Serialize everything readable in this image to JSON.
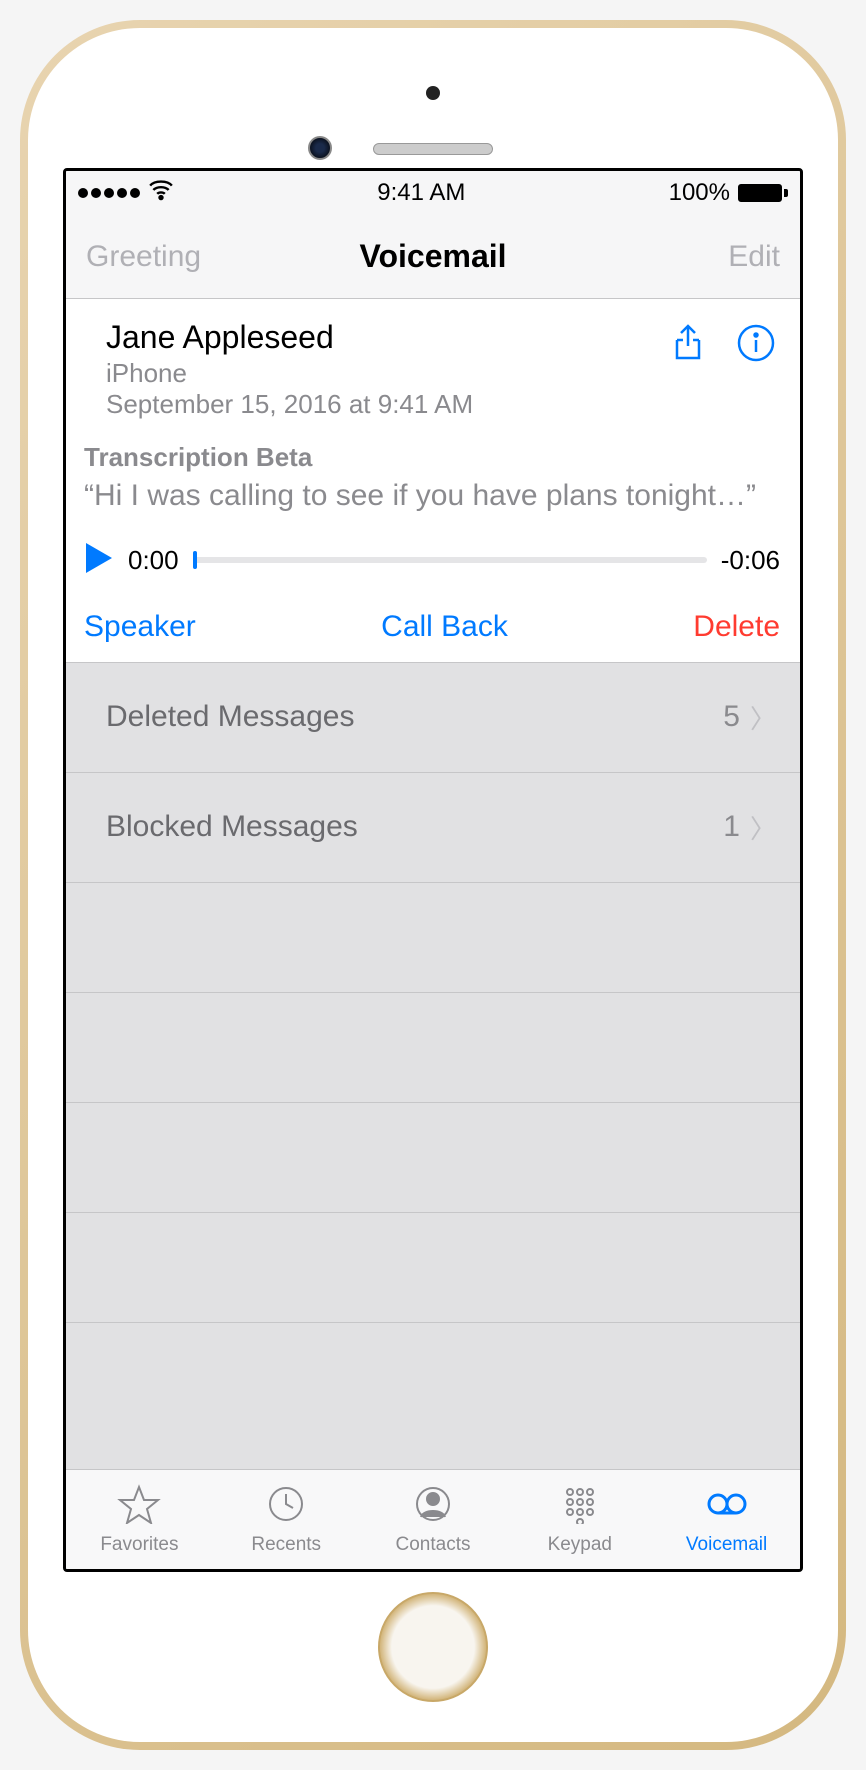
{
  "statusbar": {
    "time": "9:41 AM",
    "battery": "100%"
  },
  "navbar": {
    "left": "Greeting",
    "title": "Voicemail",
    "right": "Edit"
  },
  "voicemail": {
    "name": "Jane Appleseed",
    "source": "iPhone",
    "date": "September 15, 2016 at 9:41 AM",
    "transcription_label": "Transcription Beta",
    "transcription_text": "“Hi I was calling to see if you have plans tonight…”",
    "time_start": "0:00",
    "time_end": "-0:06",
    "speaker": "Speaker",
    "callback": "Call Back",
    "delete": "Delete"
  },
  "lists": {
    "deleted": {
      "label": "Deleted Messages",
      "count": "5"
    },
    "blocked": {
      "label": "Blocked Messages",
      "count": "1"
    }
  },
  "tabs": {
    "favorites": "Favorites",
    "recents": "Recents",
    "contacts": "Contacts",
    "keypad": "Keypad",
    "voicemail": "Voicemail"
  },
  "colors": {
    "accent": "#007aff",
    "destructive": "#ff3b30",
    "secondary_text": "#8a8a8e"
  }
}
